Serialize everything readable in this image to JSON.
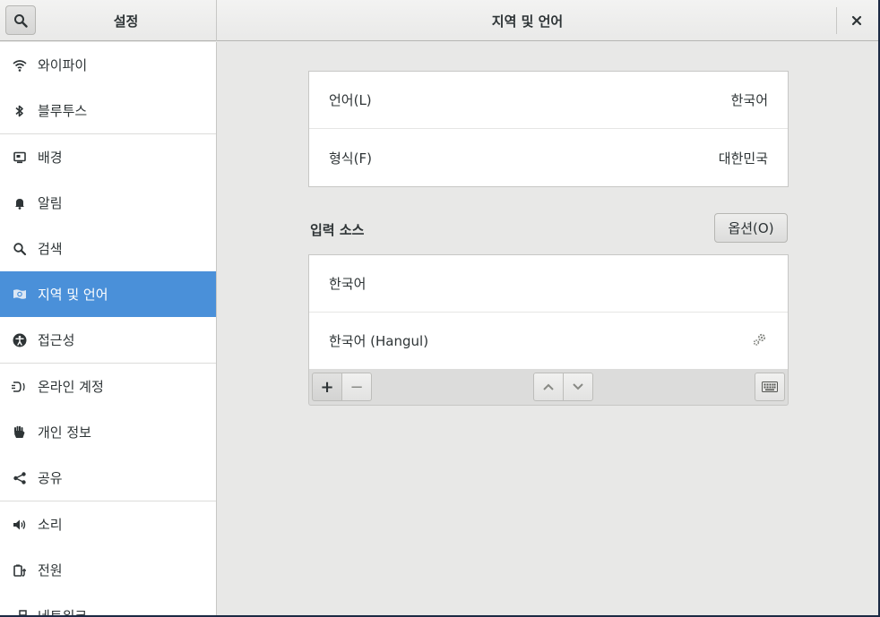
{
  "header": {
    "sidebar_title": "설정",
    "title": "지역 및 언어",
    "search_icon": "search-icon",
    "close_label": "×"
  },
  "sidebar": {
    "items": [
      {
        "label": "와이파이",
        "icon": "wifi-icon"
      },
      {
        "label": "블루투스",
        "icon": "bluetooth-icon"
      },
      {
        "label": "배경",
        "icon": "background-icon"
      },
      {
        "label": "알림",
        "icon": "bell-icon"
      },
      {
        "label": "검색",
        "icon": "search-icon"
      },
      {
        "label": "지역 및 언어",
        "icon": "flag-icon",
        "active": true
      },
      {
        "label": "접근성",
        "icon": "accessibility-icon"
      },
      {
        "label": "온라인 계정",
        "icon": "online-accounts-icon"
      },
      {
        "label": "개인 정보",
        "icon": "hand-icon"
      },
      {
        "label": "공유",
        "icon": "share-icon"
      },
      {
        "label": "소리",
        "icon": "speaker-icon"
      },
      {
        "label": "전원",
        "icon": "power-icon"
      },
      {
        "label": "네트워크",
        "icon": "network-icon"
      }
    ],
    "accent_color": "#4a90d9"
  },
  "main": {
    "language_label": "언어(L)",
    "language_value": "한국어",
    "formats_label": "형식(F)",
    "formats_value": "대한민국",
    "input_sources_title": "입력 소스",
    "options_button": "옵션(O)",
    "input_sources": [
      {
        "label": "한국어"
      },
      {
        "label": "한국어 (Hangul)",
        "has_settings": true
      }
    ],
    "toolbar": {
      "add_label": "+",
      "remove_label": "−"
    }
  }
}
